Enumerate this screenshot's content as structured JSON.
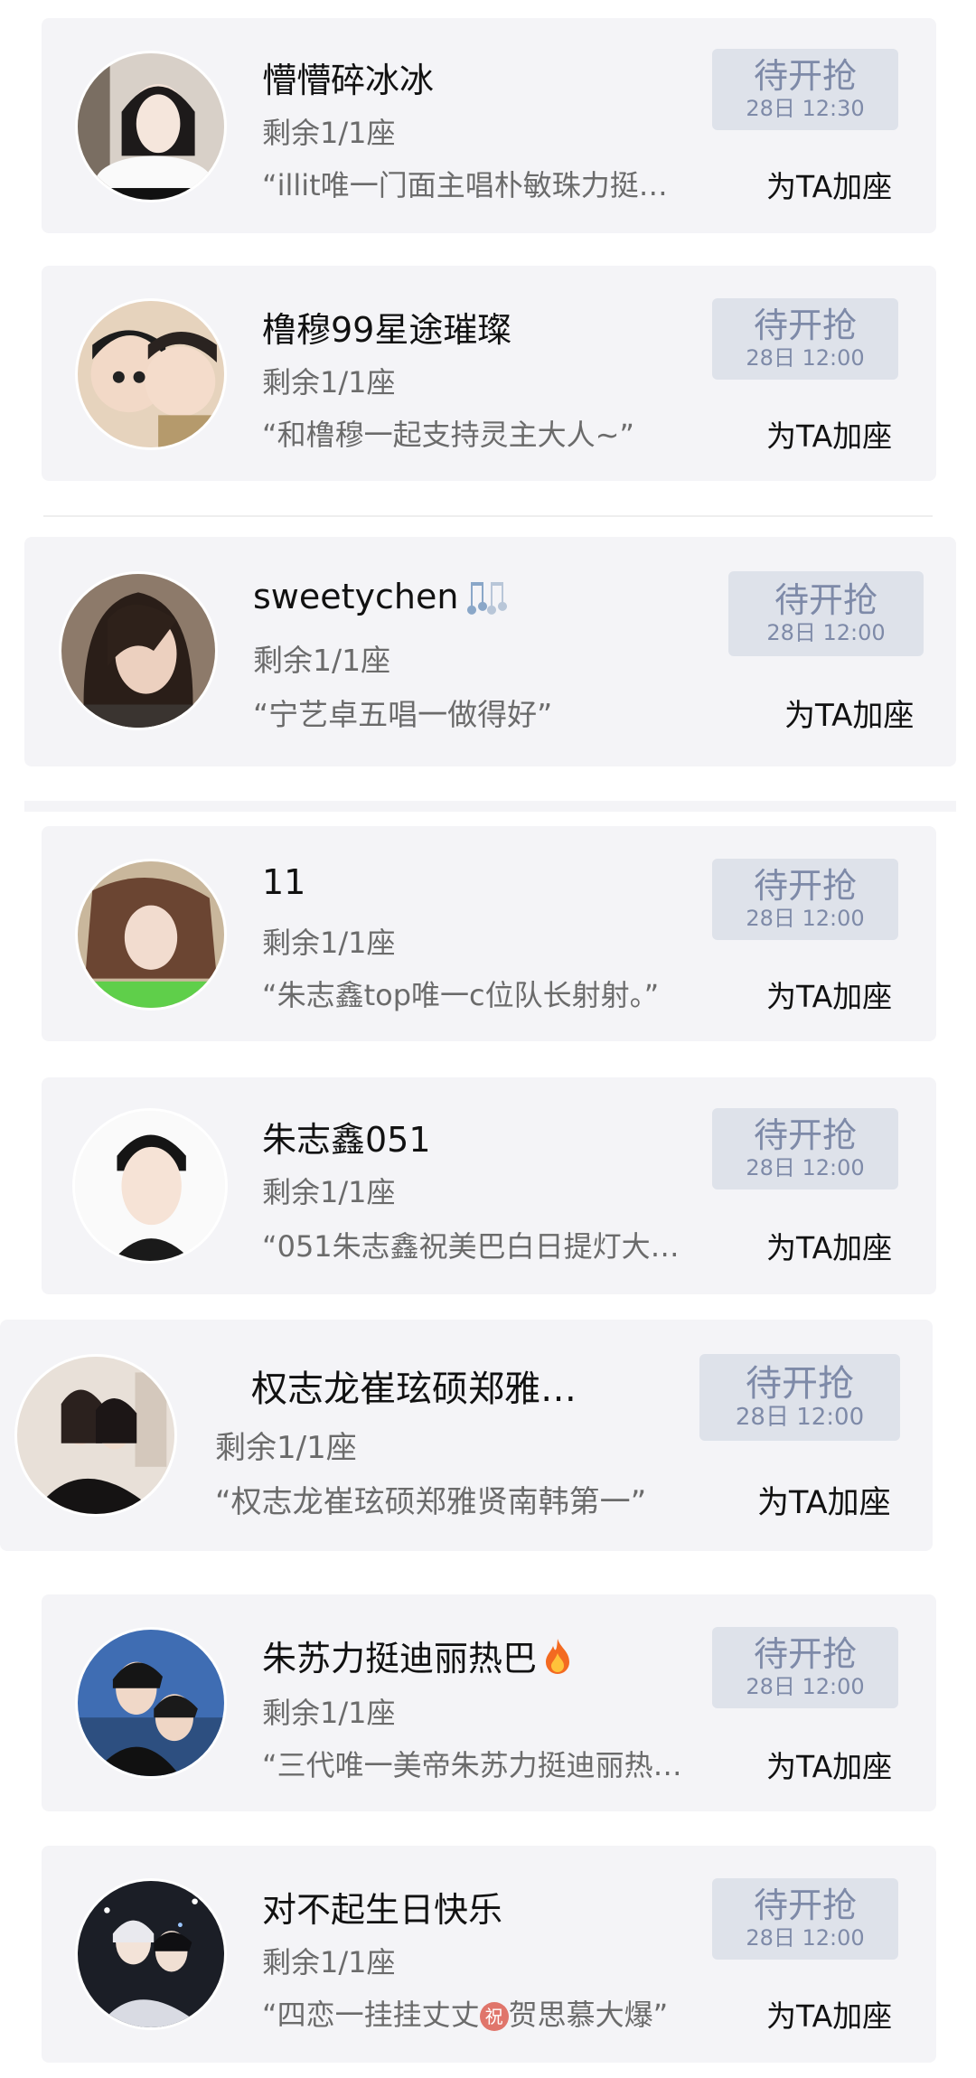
{
  "items": [
    {
      "name": "懵懵碎冰冰",
      "seats": "剩余1/1座",
      "message": "“illit唯一门面主唱朴敏珠力挺…",
      "grab": "待开抢",
      "time": "28日 12:30",
      "add": "为TA加座"
    },
    {
      "name": "橹穆99星途璀璨",
      "seats": "剩余1/1座",
      "message": "“和橹穆一起支持灵主大人~”",
      "grab": "待开抢",
      "time": "28日 12:00",
      "add": "为TA加座"
    },
    {
      "name": "sweetychen",
      "seats": "剩余1/1座",
      "message": "“宁艺卓五唱一做得好”",
      "grab": "待开抢",
      "time": "28日 12:00",
      "add": "为TA加座"
    },
    {
      "name": "11",
      "seats": "剩余1/1座",
      "message": "“朱志鑫top唯一c位队长射射。”",
      "grab": "待开抢",
      "time": "28日 12:00",
      "add": "为TA加座"
    },
    {
      "name": "朱志鑫051",
      "seats": "剩余1/1座",
      "message": "“051朱志鑫祝美巴白日提灯大…",
      "grab": "待开抢",
      "time": "28日 12:00",
      "add": "为TA加座"
    },
    {
      "name": "权志龙崔玹硕郑雅…",
      "seats": "剩余1/1座",
      "message": "“权志龙崔玹硕郑雅贤南韩第一”",
      "grab": "待开抢",
      "time": "28日 12:00",
      "add": "为TA加座"
    },
    {
      "name": "朱苏力挺迪丽热巴",
      "seats": "剩余1/1座",
      "message": "“三代唯一美帝朱苏力挺迪丽热…",
      "grab": "待开抢",
      "time": "28日 12:00",
      "add": "为TA加座"
    },
    {
      "name": "对不起生日快乐",
      "seats": "剩余1/1座",
      "message_before": "“四恋一挂挂丈丈",
      "message_emoji": "祝",
      "message_after": "贺思慕大爆”",
      "grab": "待开抢",
      "time": "28日 12:00",
      "add": "为TA加座"
    }
  ],
  "icons": {
    "item3_name_icon": "music-notes-icon",
    "item7_name_icon": "fire-icon",
    "item8_message_icon": "congrats-emoji-icon"
  },
  "colors": {
    "card_bg": "#f4f4f7",
    "grab_bg": "#dee2ea",
    "grab_text": "#7e8aa8"
  }
}
